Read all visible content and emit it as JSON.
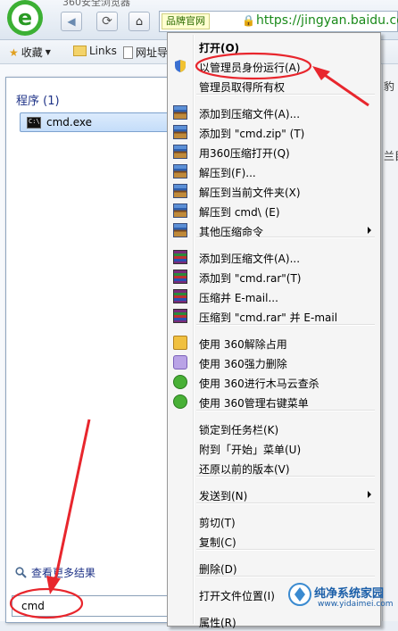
{
  "window": {
    "title": "360安全浏览器"
  },
  "address_bar": {
    "badge": "品牌官网",
    "url": "https://jingyan.baidu.com"
  },
  "bookmarks": [
    {
      "label": "收藏",
      "icon": "star-icon"
    },
    {
      "label": "Links",
      "icon": "folder-icon"
    },
    {
      "label": "网址导",
      "icon": "page-icon"
    }
  ],
  "start_menu": {
    "programs_header": "程序 (1)",
    "result_item": "cmd.exe",
    "see_more": "查看更多结果",
    "search_value": "cmd"
  },
  "page_fragments": {
    "right_text_1": "豹",
    "right_text_2": "兰目"
  },
  "context_menu": {
    "items": [
      {
        "label": "打开(O)",
        "icon": "none",
        "bold": true
      },
      {
        "label": "以管理员身份运行(A)",
        "icon": "uac-shield-icon",
        "highlighted": true
      },
      {
        "label": "管理员取得所有权",
        "icon": "none"
      },
      {
        "label": "添加到压缩文件(A)...",
        "icon": "zip-archive-icon"
      },
      {
        "label": "添加到 \"cmd.zip\" (T)",
        "icon": "zip-archive-icon"
      },
      {
        "label": "用360压缩打开(Q)",
        "icon": "zip-archive-icon"
      },
      {
        "label": "解压到(F)...",
        "icon": "zip-archive-icon"
      },
      {
        "label": "解压到当前文件夹(X)",
        "icon": "zip-archive-icon"
      },
      {
        "label": "解压到 cmd\\ (E)",
        "icon": "zip-archive-icon"
      },
      {
        "label": "其他压缩命令",
        "icon": "zip-archive-icon",
        "submenu": true
      },
      {
        "label": "添加到压缩文件(A)...",
        "icon": "rar-archive-icon"
      },
      {
        "label": "添加到 \"cmd.rar\"(T)",
        "icon": "rar-archive-icon"
      },
      {
        "label": "压缩并 E-mail...",
        "icon": "rar-archive-icon"
      },
      {
        "label": "压缩到 \"cmd.rar\" 并 E-mail",
        "icon": "rar-archive-icon"
      },
      {
        "label": "使用 360解除占用",
        "icon": "unlock-360-icon"
      },
      {
        "label": "使用 360强力删除",
        "icon": "shred-360-icon"
      },
      {
        "label": "使用 360进行木马云查杀",
        "icon": "scan-360-icon"
      },
      {
        "label": "使用 360管理右键菜单",
        "icon": "menu-360-icon"
      },
      {
        "label": "锁定到任务栏(K)",
        "icon": "none"
      },
      {
        "label": "附到「开始」菜单(U)",
        "icon": "none"
      },
      {
        "label": "还原以前的版本(V)",
        "icon": "none"
      },
      {
        "label": "发送到(N)",
        "icon": "none",
        "submenu": true
      },
      {
        "label": "剪切(T)",
        "icon": "none"
      },
      {
        "label": "复制(C)",
        "icon": "none"
      },
      {
        "label": "删除(D)",
        "icon": "none"
      },
      {
        "label": "打开文件位置(I)",
        "icon": "none"
      },
      {
        "label": "属性(R)",
        "icon": "none"
      }
    ]
  },
  "watermark": {
    "title": "纯净系统家园",
    "url": "www.yidaimei.com"
  },
  "colors": {
    "annotation": "#e8262d",
    "link": "#1e3287",
    "url_green": "#1a8a1a"
  }
}
